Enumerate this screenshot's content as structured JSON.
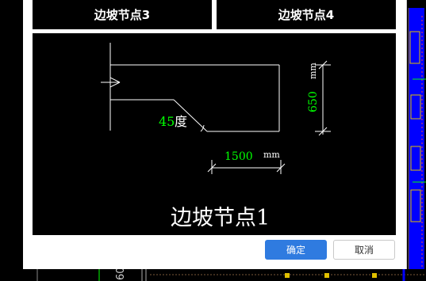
{
  "tabs": {
    "node3_label": "边坡节点3",
    "node4_label": "边坡节点4"
  },
  "preview": {
    "angle_value": "45",
    "angle_unit": "度",
    "height_value": "650",
    "height_unit": "mm",
    "width_value": "1500",
    "width_unit": "mm",
    "caption": "边坡节点1"
  },
  "buttons": {
    "ok_label": "确定",
    "cancel_label": "取消"
  },
  "background": {
    "bottom_dim_text": "60"
  },
  "colors": {
    "accent": "#2f7be0",
    "dimension_green": "#00ff00",
    "cad_blue": "#0000ff"
  }
}
